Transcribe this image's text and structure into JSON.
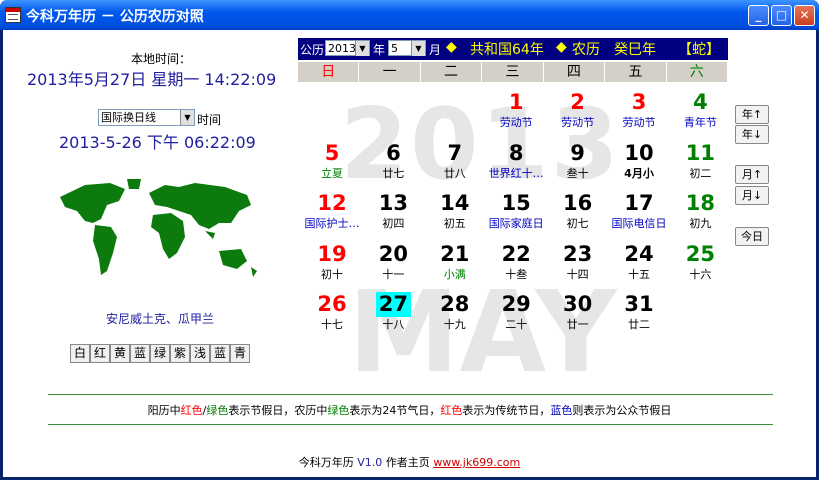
{
  "window": {
    "title": "今科万年历 － 公历农历对照",
    "minimize": "_",
    "maximize": "□",
    "close": "✕"
  },
  "left": {
    "local_time_label": "本地时间：",
    "local_time": "2013年5月27日  星期一  14:22:09",
    "zone_select": "国际换日线",
    "zone_time_label": "时间",
    "zone_time": "2013-5-26 下午  06:22:09",
    "place": "安尼威土克、瓜甲兰",
    "color_buttons": [
      "白",
      "红",
      "黄",
      "蓝",
      "绿",
      "紫",
      "浅",
      "蓝",
      "青"
    ]
  },
  "topbar": {
    "calendar_label": "公历",
    "year_value": "2013",
    "year_unit": "年",
    "month_value": "5",
    "month_unit": "月",
    "diamond1": "◆",
    "republic": "共和国64年",
    "diamond2": "◆",
    "lunar_label": "农历",
    "ganzhi": "癸巳年",
    "zodiac": "【蛇】"
  },
  "weekdays": [
    "日",
    "一",
    "二",
    "三",
    "四",
    "五",
    "六"
  ],
  "watermark": {
    "year": "2013",
    "month": "MAY"
  },
  "days": [
    {
      "d": "1",
      "s": "劳动节",
      "col": 3,
      "row": 0,
      "dc": "red",
      "sc": "blue"
    },
    {
      "d": "2",
      "s": "劳动节",
      "col": 4,
      "row": 0,
      "dc": "red",
      "sc": "blue"
    },
    {
      "d": "3",
      "s": "劳动节",
      "col": 5,
      "row": 0,
      "dc": "red",
      "sc": "blue"
    },
    {
      "d": "4",
      "s": "青年节",
      "col": 6,
      "row": 0,
      "dc": "green",
      "sc": "blue"
    },
    {
      "d": "5",
      "s": "立夏",
      "col": 0,
      "row": 1,
      "dc": "red",
      "sc": "green"
    },
    {
      "d": "6",
      "s": "廿七",
      "col": 1,
      "row": 1,
      "dc": "black",
      "sc": "black"
    },
    {
      "d": "7",
      "s": "廿八",
      "col": 2,
      "row": 1,
      "dc": "black",
      "sc": "black"
    },
    {
      "d": "8",
      "s": "世界红十…",
      "col": 3,
      "row": 1,
      "dc": "black",
      "sc": "blue"
    },
    {
      "d": "9",
      "s": "叁十",
      "col": 4,
      "row": 1,
      "dc": "black",
      "sc": "black"
    },
    {
      "d": "10",
      "s": "4月小",
      "col": 5,
      "row": 1,
      "dc": "black",
      "sc": "black"
    },
    {
      "d": "11",
      "s": "初二",
      "col": 6,
      "row": 1,
      "dc": "green",
      "sc": "black"
    },
    {
      "d": "12",
      "s": "国际护士…",
      "col": 0,
      "row": 2,
      "dc": "red",
      "sc": "blue"
    },
    {
      "d": "13",
      "s": "初四",
      "col": 1,
      "row": 2,
      "dc": "black",
      "sc": "black"
    },
    {
      "d": "14",
      "s": "初五",
      "col": 2,
      "row": 2,
      "dc": "black",
      "sc": "black"
    },
    {
      "d": "15",
      "s": "国际家庭日",
      "col": 3,
      "row": 2,
      "dc": "black",
      "sc": "blue"
    },
    {
      "d": "16",
      "s": "初七",
      "col": 4,
      "row": 2,
      "dc": "black",
      "sc": "black"
    },
    {
      "d": "17",
      "s": "国际电信日",
      "col": 5,
      "row": 2,
      "dc": "black",
      "sc": "blue"
    },
    {
      "d": "18",
      "s": "初九",
      "col": 6,
      "row": 2,
      "dc": "green",
      "sc": "black"
    },
    {
      "d": "19",
      "s": "初十",
      "col": 0,
      "row": 3,
      "dc": "red",
      "sc": "black"
    },
    {
      "d": "20",
      "s": "十一",
      "col": 1,
      "row": 3,
      "dc": "black",
      "sc": "black"
    },
    {
      "d": "21",
      "s": "小满",
      "col": 2,
      "row": 3,
      "dc": "black",
      "sc": "green"
    },
    {
      "d": "22",
      "s": "十叁",
      "col": 3,
      "row": 3,
      "dc": "black",
      "sc": "black"
    },
    {
      "d": "23",
      "s": "十四",
      "col": 4,
      "row": 3,
      "dc": "black",
      "sc": "black"
    },
    {
      "d": "24",
      "s": "十五",
      "col": 5,
      "row": 3,
      "dc": "black",
      "sc": "black"
    },
    {
      "d": "25",
      "s": "十六",
      "col": 6,
      "row": 3,
      "dc": "green",
      "sc": "black"
    },
    {
      "d": "26",
      "s": "十七",
      "col": 0,
      "row": 4,
      "dc": "red",
      "sc": "black"
    },
    {
      "d": "27",
      "s": "十八",
      "col": 1,
      "row": 4,
      "dc": "black",
      "sc": "black",
      "today": true
    },
    {
      "d": "28",
      "s": "十九",
      "col": 2,
      "row": 4,
      "dc": "black",
      "sc": "black"
    },
    {
      "d": "29",
      "s": "二十",
      "col": 3,
      "row": 4,
      "dc": "black",
      "sc": "black"
    },
    {
      "d": "30",
      "s": "廿一",
      "col": 4,
      "row": 4,
      "dc": "black",
      "sc": "black"
    },
    {
      "d": "31",
      "s": "廿二",
      "col": 5,
      "row": 4,
      "dc": "black",
      "sc": "black"
    }
  ],
  "side": {
    "year_up": "年↑",
    "year_down": "年↓",
    "month_up": "月↑",
    "month_down": "月↓",
    "today": "今日"
  },
  "note": [
    {
      "t": "阳历中",
      "c": "#000"
    },
    {
      "t": "红色",
      "c": "#ff0000"
    },
    {
      "t": "/",
      "c": "#000"
    },
    {
      "t": "绿色",
      "c": "#008000"
    },
    {
      "t": "表示节假日，农历中",
      "c": "#000"
    },
    {
      "t": "绿色",
      "c": "#008000"
    },
    {
      "t": "表示为24节气日，",
      "c": "#000"
    },
    {
      "t": "红色",
      "c": "#ff0000"
    },
    {
      "t": "表示为传统节日，",
      "c": "#000"
    },
    {
      "t": "蓝色",
      "c": "#0000c0"
    },
    {
      "t": "则表示为公众节假日",
      "c": "#000"
    }
  ],
  "footer": {
    "name": "今科万年历",
    "version": "V1.0",
    "author": "作者主页",
    "url": "www.jk699.com"
  }
}
